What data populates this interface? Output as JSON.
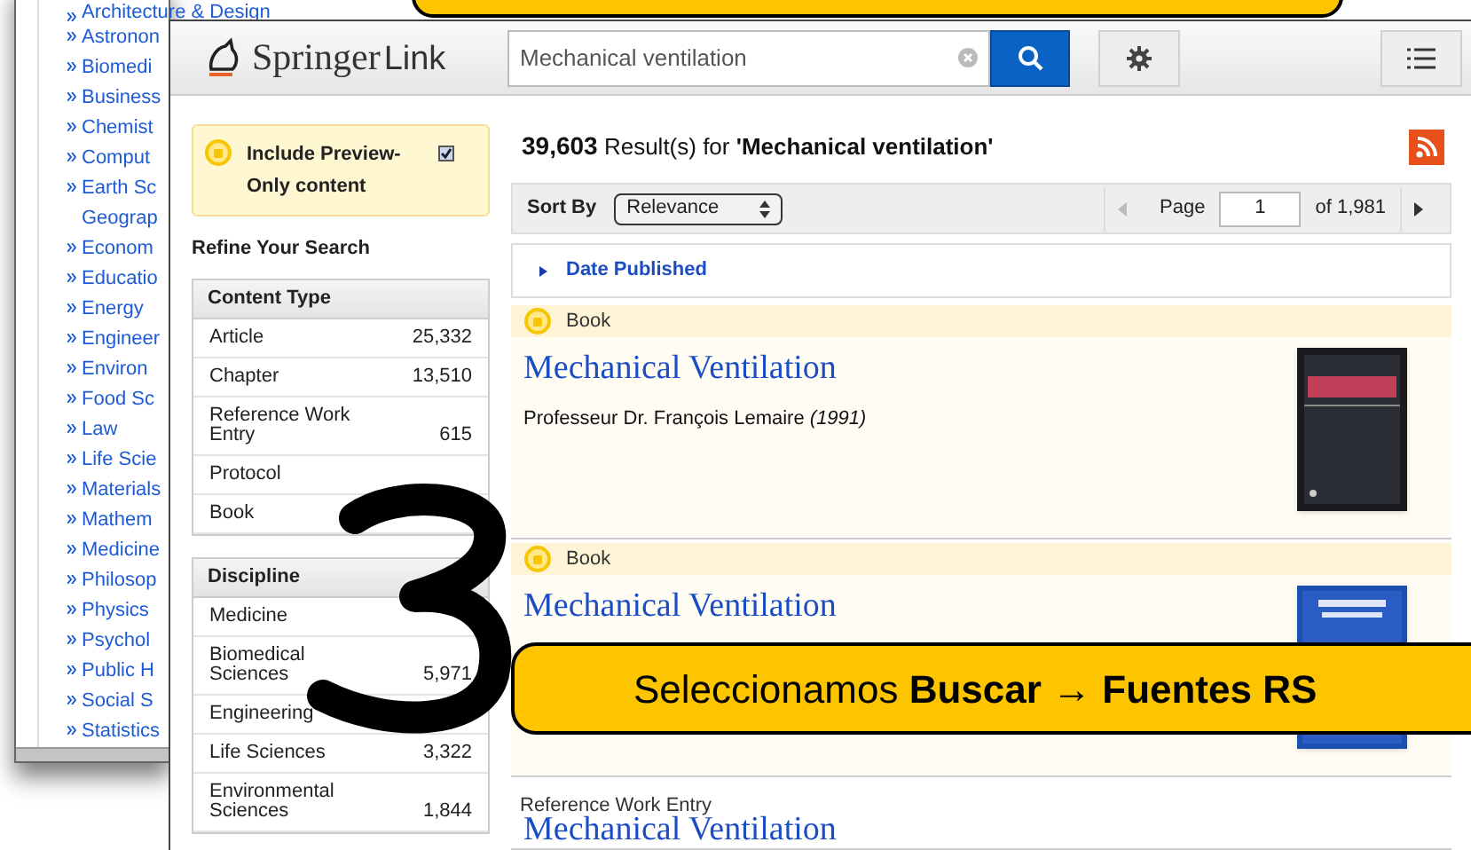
{
  "background_window": {
    "subjects": [
      "Architecture & Design",
      "Astronon",
      "Biomedi",
      "Business",
      "Chemist",
      "Comput",
      "Earth Sc\nGeograp",
      "Econom",
      "Educatio",
      "Energy",
      "Engineer",
      "Environ",
      "Food Sc",
      "Law",
      "Life Scie",
      "Materials",
      "Mathem",
      "Medicine",
      "Philosop",
      "Physics",
      "Psychol",
      "Public H",
      "Social S",
      "Statistics"
    ]
  },
  "header": {
    "logo_left": "Springer",
    "logo_right": "Link",
    "search": {
      "value": "Mechanical ventilation"
    }
  },
  "preview_filter": {
    "label": "Include Preview-Only content",
    "checked": true
  },
  "sidebar": {
    "title": "Refine Your Search",
    "facets": [
      {
        "title": "Content Type",
        "items": [
          {
            "label": "Article",
            "count": "25,332"
          },
          {
            "label": "Chapter",
            "count": "13,510"
          },
          {
            "label": "Reference Work Entry",
            "count": "615"
          },
          {
            "label": "Protocol"
          },
          {
            "label": "Book"
          }
        ]
      },
      {
        "title": "Discipline",
        "items": [
          {
            "label": "Medicine"
          },
          {
            "label": "Biomedical Sciences",
            "count": "5,971"
          },
          {
            "label": "Engineering"
          },
          {
            "label": "Life Sciences",
            "count": "3,322"
          },
          {
            "label": "Environmental Sciences",
            "count": "1,844"
          }
        ]
      }
    ]
  },
  "results_header": {
    "count": "39,603",
    "text": "Result(s) for",
    "query": "'Mechanical ventilation'"
  },
  "toolbar": {
    "sort_label": "Sort By",
    "sort_value": "Relevance",
    "page_label": "Page",
    "page_value": "1",
    "page_total": "of 1,981"
  },
  "date_filter": {
    "label": "Date Published",
    "expanded": false
  },
  "results": [
    {
      "type": "Book",
      "preview": true,
      "title": "Mechanical Ventilation",
      "author": "Professeur Dr. François Lemaire",
      "year": "(1991)"
    },
    {
      "type": "Book",
      "preview": true,
      "title": "Mechanical Ventilation"
    },
    {
      "type": "Reference Work Entry",
      "preview": false,
      "title": "Mechanical Ventilation"
    }
  ],
  "callout": {
    "text": "Seleccionamos **Buscar → Fuentes RS**"
  }
}
